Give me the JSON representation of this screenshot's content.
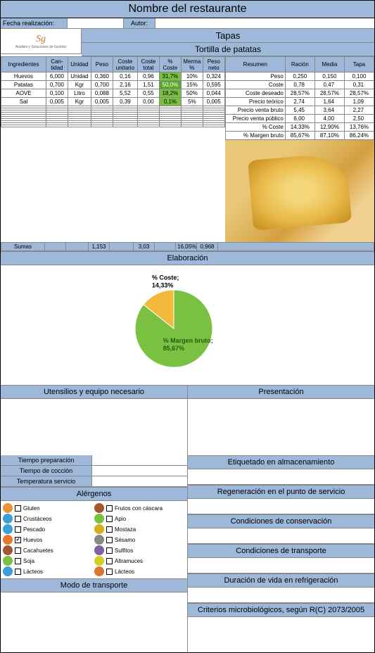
{
  "title": "Nombre del restaurante",
  "header": {
    "fecha_lbl": "Fecha realización:",
    "autor_lbl": "Autor:",
    "logo_brand": "Sg",
    "logo_tagline": "Análisis y Soluciones de Gestión"
  },
  "category": "Tapas",
  "dish": "Tortilla de patatas",
  "ing_headers": [
    "Ingredientes",
    "Can-tidad",
    "Unidad",
    "Peso",
    "Coste unitario",
    "Coste total",
    "% Coste",
    "Merma %",
    "Peso neto"
  ],
  "ingredients": [
    {
      "name": "Huevos",
      "cant": "6,000",
      "unidad": "Unidad",
      "peso": "0,360",
      "cu": "0,16",
      "ct": "0,96",
      "pc": "31,7%",
      "merma": "10%",
      "pn": "0,324"
    },
    {
      "name": "Patatas",
      "cant": "0,700",
      "unidad": "Kgr",
      "peso": "0,700",
      "cu": "2,16",
      "ct": "1,51",
      "pc": "50,0%",
      "merma": "15%",
      "pn": "0,595"
    },
    {
      "name": "AOVE",
      "cant": "0,100",
      "unidad": "Litro",
      "peso": "0,088",
      "cu": "5,52",
      "ct": "0,55",
      "pc": "18,2%",
      "merma": "50%",
      "pn": "0,044"
    },
    {
      "name": "Sal",
      "cant": "0,005",
      "unidad": "Kgr",
      "peso": "0,005",
      "cu": "0,39",
      "ct": "0,00",
      "pc": "0,1%",
      "merma": "5%",
      "pn": "0,005"
    }
  ],
  "sums": {
    "label": "Sumas",
    "peso": "1,153",
    "ct": "3,03",
    "merma": "16,05%",
    "pn": "0,968"
  },
  "resumen_headers": [
    "Resumen",
    "Ración",
    "Media",
    "Tapa"
  ],
  "resumen": [
    {
      "k": "Peso",
      "r": "0,250",
      "m": "0,150",
      "t": "0,100"
    },
    {
      "k": "Coste",
      "r": "0,78 ‎",
      "m": "0,47 ‎",
      "t": "0,31 ‎"
    },
    {
      "k": "Coste deseado",
      "r": "28,57%",
      "m": "28,57%",
      "t": "28,57%"
    },
    {
      "k": "Precio teórico",
      "r": "2,74 ‎",
      "m": "1,64 ‎",
      "t": "1,09 ‎"
    },
    {
      "k": "Precio venta bruto",
      "r": "5,45 ‎",
      "m": "3,64 ‎",
      "t": "2,27 ‎"
    },
    {
      "k": "Precio venta público",
      "r": "6,00 ‎",
      "m": "4,00 ‎",
      "t": "2,50 ‎"
    },
    {
      "k": "% Coste",
      "r": "14,33%",
      "m": "12,90%",
      "t": "13,76%"
    },
    {
      "k": "% Margen bruto",
      "r": "85,67%",
      "m": "87,10%",
      "t": "86,24%"
    }
  ],
  "sections": {
    "elaboracion": "Elaboración",
    "utensilios": "Utensilios y equipo necesario",
    "presentacion": "Presentación",
    "tiempo_prep": "Tiempo preparación",
    "tiempo_coc": "Tiempo de cocción",
    "temp_serv": "Temperatura servicio",
    "alergenos": "Alérgenos",
    "modo_transporte": "Modo de transporte",
    "etiquetado": "Etiquetado en almacenamiento",
    "regeneracion": "Regeneración en el punto de servicio",
    "cond_conserv": "Condiciones de conservación",
    "cond_transp": "Condiciones de transporte",
    "duracion": "Duración de vida en refrigeración",
    "criterios": "Criterios microbiológicos, según R(C) 2073/2005"
  },
  "chart_data": {
    "type": "pie",
    "title": "",
    "series": [
      {
        "name": "% Margen bruto;",
        "value": 85.67,
        "label": "85,67%",
        "color": "#7ac142"
      },
      {
        "name": "% Coste;",
        "value": 14.33,
        "label": "14,33%",
        "color": "#f4b83e"
      }
    ]
  },
  "allergens": [
    {
      "name": "Gluten",
      "color": "#e8923c",
      "checked": false
    },
    {
      "name": "Frutos con cáscara",
      "color": "#a05830",
      "checked": false
    },
    {
      "name": "Crustáceos",
      "color": "#3ca0d8",
      "checked": false
    },
    {
      "name": "Apio",
      "color": "#7ac142",
      "checked": false
    },
    {
      "name": "Pescado",
      "color": "#3ca0d8",
      "checked": false
    },
    {
      "name": "Mostaza",
      "color": "#d4b020",
      "checked": false
    },
    {
      "name": "Huevos",
      "color": "#e87830",
      "checked": true
    },
    {
      "name": "Sésamo",
      "color": "#888",
      "checked": false
    },
    {
      "name": "Cacahuetes",
      "color": "#a05830",
      "checked": false
    },
    {
      "name": "Sulfitos",
      "color": "#8060a0",
      "checked": false
    },
    {
      "name": "Soja",
      "color": "#7ac142",
      "checked": false
    },
    {
      "name": "Altramuces",
      "color": "#d4d020",
      "checked": false
    },
    {
      "name": "Lácteos",
      "color": "#3ca0d8",
      "checked": false
    },
    {
      "name": "Lácteos",
      "color": "#d87830",
      "checked": false
    }
  ]
}
